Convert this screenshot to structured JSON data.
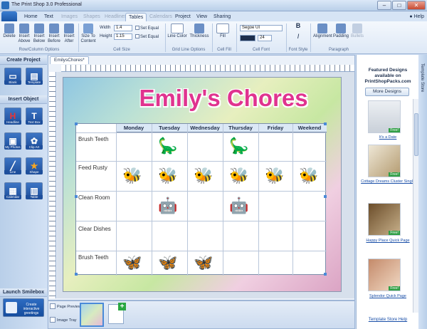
{
  "window": {
    "title": "The Print Shop 3.0 Professional",
    "min": "–",
    "max": "□",
    "close": "✕"
  },
  "menu_tabs": [
    {
      "label": "Home",
      "state": "normal"
    },
    {
      "label": "Text",
      "state": "normal"
    },
    {
      "label": "Images",
      "state": "disabled"
    },
    {
      "label": "Shapes",
      "state": "disabled"
    },
    {
      "label": "Headlines",
      "state": "disabled"
    },
    {
      "label": "Tables",
      "state": "active"
    },
    {
      "label": "Calendars",
      "state": "disabled"
    },
    {
      "label": "Project",
      "state": "normal"
    },
    {
      "label": "View",
      "state": "normal"
    },
    {
      "label": "Sharing",
      "state": "normal"
    }
  ],
  "help": "Help",
  "ribbon": {
    "row_col": {
      "delete": "Delete",
      "insert_above": "Insert Above",
      "insert_below": "Insert Below",
      "insert_before": "Insert Before",
      "insert_after": "Insert After",
      "group": "Row/Column Options"
    },
    "cell_size": {
      "size_to_content": "Size To Content",
      "width_label": "Width",
      "width_value": "1.4",
      "height_label": "Height",
      "height_value": "1.15",
      "set_equal_1": "Set Equal",
      "set_equal_2": "Set Equal",
      "group": "Cell Size"
    },
    "grid_line": {
      "line_color": "Line Color",
      "thickness": "Thickness",
      "group": "Grid Line Options"
    },
    "cell_fill": {
      "fill": "Fill",
      "group": "Cell Fill"
    },
    "cell_font": {
      "font_name": "Segoe UI",
      "font_size": "24",
      "group": "Cell Font"
    },
    "font_style": {
      "group": "Font Style"
    },
    "paragraph": {
      "alignment": "Alignment",
      "padding": "Padding",
      "bullets": "Bullets",
      "group": "Paragraph"
    }
  },
  "left_panel": {
    "create_project": "Create Project",
    "blank": "Blank",
    "template": "Template",
    "insert_object": "Insert Object",
    "objects": [
      "Headline",
      "Text Box",
      "My Photos",
      "Clip Art",
      "Line",
      "Shape",
      "Calendar",
      "Table"
    ],
    "launch_smilebox": "Launch Smilebox",
    "smilebox_btn": "Create interactive greetings"
  },
  "document": {
    "tab": "EmilysChores*",
    "title": "Emily's Chores",
    "days": [
      "Monday",
      "Tuesday",
      "Wednesday",
      "Thursday",
      "Friday",
      "Weekend"
    ],
    "chores": [
      "Brush Teeth",
      "Feed Rusty",
      "Clean Room",
      "Clear Dishes",
      "Brush Teeth"
    ],
    "stickers": {
      "dino": "🦕",
      "bee": "🐝",
      "robot": "🤖",
      "butterfly": "🦋"
    }
  },
  "bottom_strip": {
    "page_preview": "Page Preview",
    "image_tray": "Image Tray",
    "add": "+"
  },
  "right_panel": {
    "featured": "Featured Designs available on PrintShopPacks.com",
    "more_designs": "More Designs",
    "free": "Free!",
    "designs": [
      "It's a Date",
      "Cottage Dreams Cluster Single",
      "Happy Place Quick Page",
      "Splendor Quick Page"
    ],
    "store_help": "Template Store Help",
    "side_tab": "Template Store"
  }
}
